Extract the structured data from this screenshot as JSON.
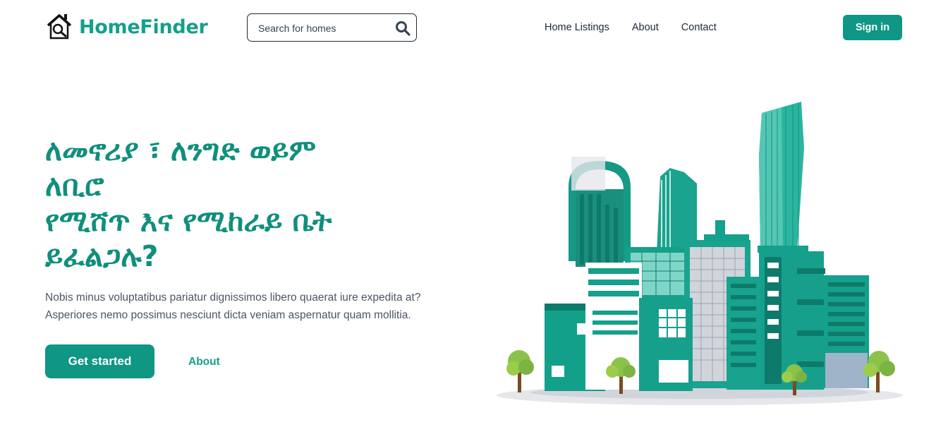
{
  "brand": {
    "name": "HomeFinder",
    "accent_color": "#0f9685",
    "logo_icon": "house-magnifier-icon"
  },
  "search": {
    "placeholder": "Search for homes",
    "icon": "search-icon"
  },
  "nav": {
    "items": [
      {
        "label": "Home Listings"
      },
      {
        "label": "About"
      },
      {
        "label": "Contact"
      }
    ]
  },
  "header": {
    "signin_label": "Sign in"
  },
  "hero": {
    "title_lines": [
      "ለመኖሪያ ፣ ለንግድ ወይም",
      "ለቢሮ",
      "የሚሸጥ እና የሚከራይ ቤት",
      "ይፈልጋሉ?"
    ],
    "description_lines": [
      "Nobis minus voluptatibus pariatur dignissimos libero quaerat iure expedita at?",
      "Asperiores nemo possimus nesciunt dicta veniam aspernatur quam mollitia."
    ],
    "primary_button": "Get started",
    "secondary_link": "About",
    "illustration": "city-buildings-illustration"
  }
}
